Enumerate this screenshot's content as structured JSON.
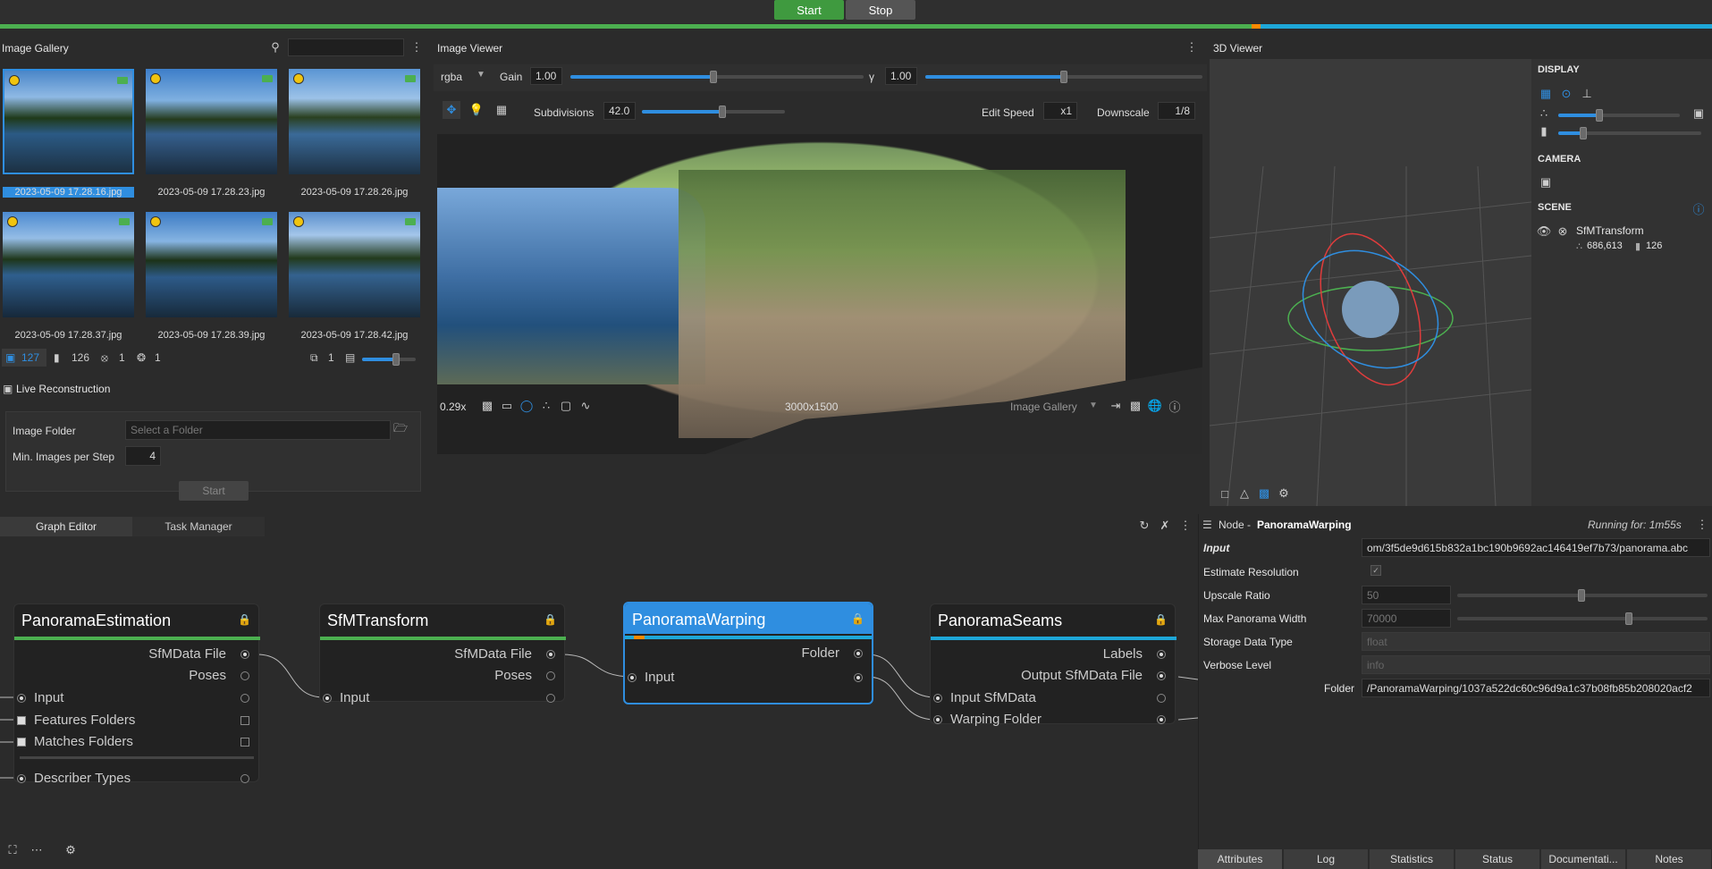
{
  "topbar": {
    "start": "Start",
    "stop": "Stop"
  },
  "gallery": {
    "title": "Image Gallery",
    "images": [
      {
        "name": "2023-05-09 17.28.16.jpg"
      },
      {
        "name": "2023-05-09 17.28.23.jpg"
      },
      {
        "name": "2023-05-09 17.28.26.jpg"
      },
      {
        "name": "2023-05-09 17.28.37.jpg"
      },
      {
        "name": "2023-05-09 17.28.39.jpg"
      },
      {
        "name": "2023-05-09 17.28.42.jpg"
      }
    ],
    "stats": {
      "images": "127",
      "cameras": "126",
      "no_intrinsics": "1",
      "rigs": "1",
      "groups": "1"
    }
  },
  "live": {
    "title": "Live Reconstruction",
    "folder_label": "Image Folder",
    "folder_placeholder": "Select a Folder",
    "min_label": "Min. Images per Step",
    "min_value": "4",
    "start": "Start"
  },
  "viewer": {
    "title": "Image Viewer",
    "channel": "rgba",
    "gain_label": "Gain",
    "gain_value": "1.00",
    "gamma_label": "γ",
    "gamma_value": "1.00",
    "subdiv_label": "Subdivisions",
    "subdiv_value": "42.0",
    "edit_speed_label": "Edit Speed",
    "edit_speed_value": "x1",
    "downscale_label": "Downscale",
    "downscale_value": "1/8",
    "zoom": "0.29x",
    "resolution": "3000x1500",
    "source": "Image Gallery"
  },
  "viewer3d": {
    "title": "3D Viewer",
    "display": "DISPLAY",
    "camera": "CAMERA",
    "scene": "SCENE",
    "scene_item": "SfMTransform",
    "points": "686,613",
    "cams": "126"
  },
  "graph": {
    "tab_graph": "Graph Editor",
    "tab_task": "Task Manager",
    "nodes": {
      "n1": {
        "title": "PanoramaEstimation",
        "out1": "SfMData File",
        "out2": "Poses",
        "in1": "Input",
        "in2": "Features Folders",
        "in3": "Matches Folders",
        "in4": "Describer Types"
      },
      "n2": {
        "title": "SfMTransform",
        "out1": "SfMData File",
        "out2": "Poses",
        "in1": "Input"
      },
      "n3": {
        "title": "PanoramaWarping",
        "out1": "Folder",
        "in1": "Input"
      },
      "n4": {
        "title": "PanoramaSeams",
        "out1": "Labels",
        "out2": "Output SfMData File",
        "in1": "Input SfMData",
        "in2": "Warping Folder"
      }
    }
  },
  "node_panel": {
    "prefix": "Node - ",
    "name": "PanoramaWarping",
    "running": "Running for: 1m55s",
    "rows": {
      "input_label": "Input",
      "input_value": "om/3f5de9d615b832a1bc190b9692ac146419ef7b73/panorama.abc",
      "estimate_label": "Estimate Resolution",
      "upscale_label": "Upscale Ratio",
      "upscale_value": "50",
      "maxwidth_label": "Max Panorama Width",
      "maxwidth_value": "70000",
      "storage_label": "Storage Data Type",
      "storage_value": "float",
      "verbose_label": "Verbose Level",
      "verbose_value": "info",
      "folder_label": "Folder",
      "folder_value": "/PanoramaWarping/1037a522dc60c96d9a1c37b08fb85b208020acf2"
    },
    "tabs": [
      "Attributes",
      "Log",
      "Statistics",
      "Status",
      "Documentati...",
      "Notes"
    ]
  },
  "colors": {
    "accent": "#2f8ee0",
    "green": "#4caf50",
    "cyan": "#1ea7d8",
    "orange": "#ff8a00"
  }
}
